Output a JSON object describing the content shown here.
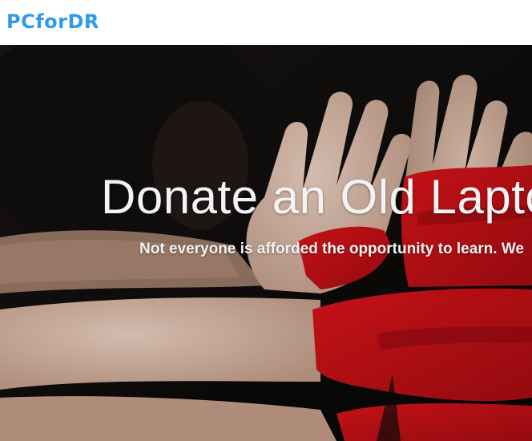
{
  "brand": {
    "logo_text": "PCforDR",
    "logo_color": "#2f9be6"
  },
  "hero": {
    "title": "Donate an Old Laptop",
    "subtitle": "Not everyone is afforded the opportunity to learn. We",
    "background_image": "hands-with-red-paint-photo",
    "accent_color": "#d0161c"
  }
}
